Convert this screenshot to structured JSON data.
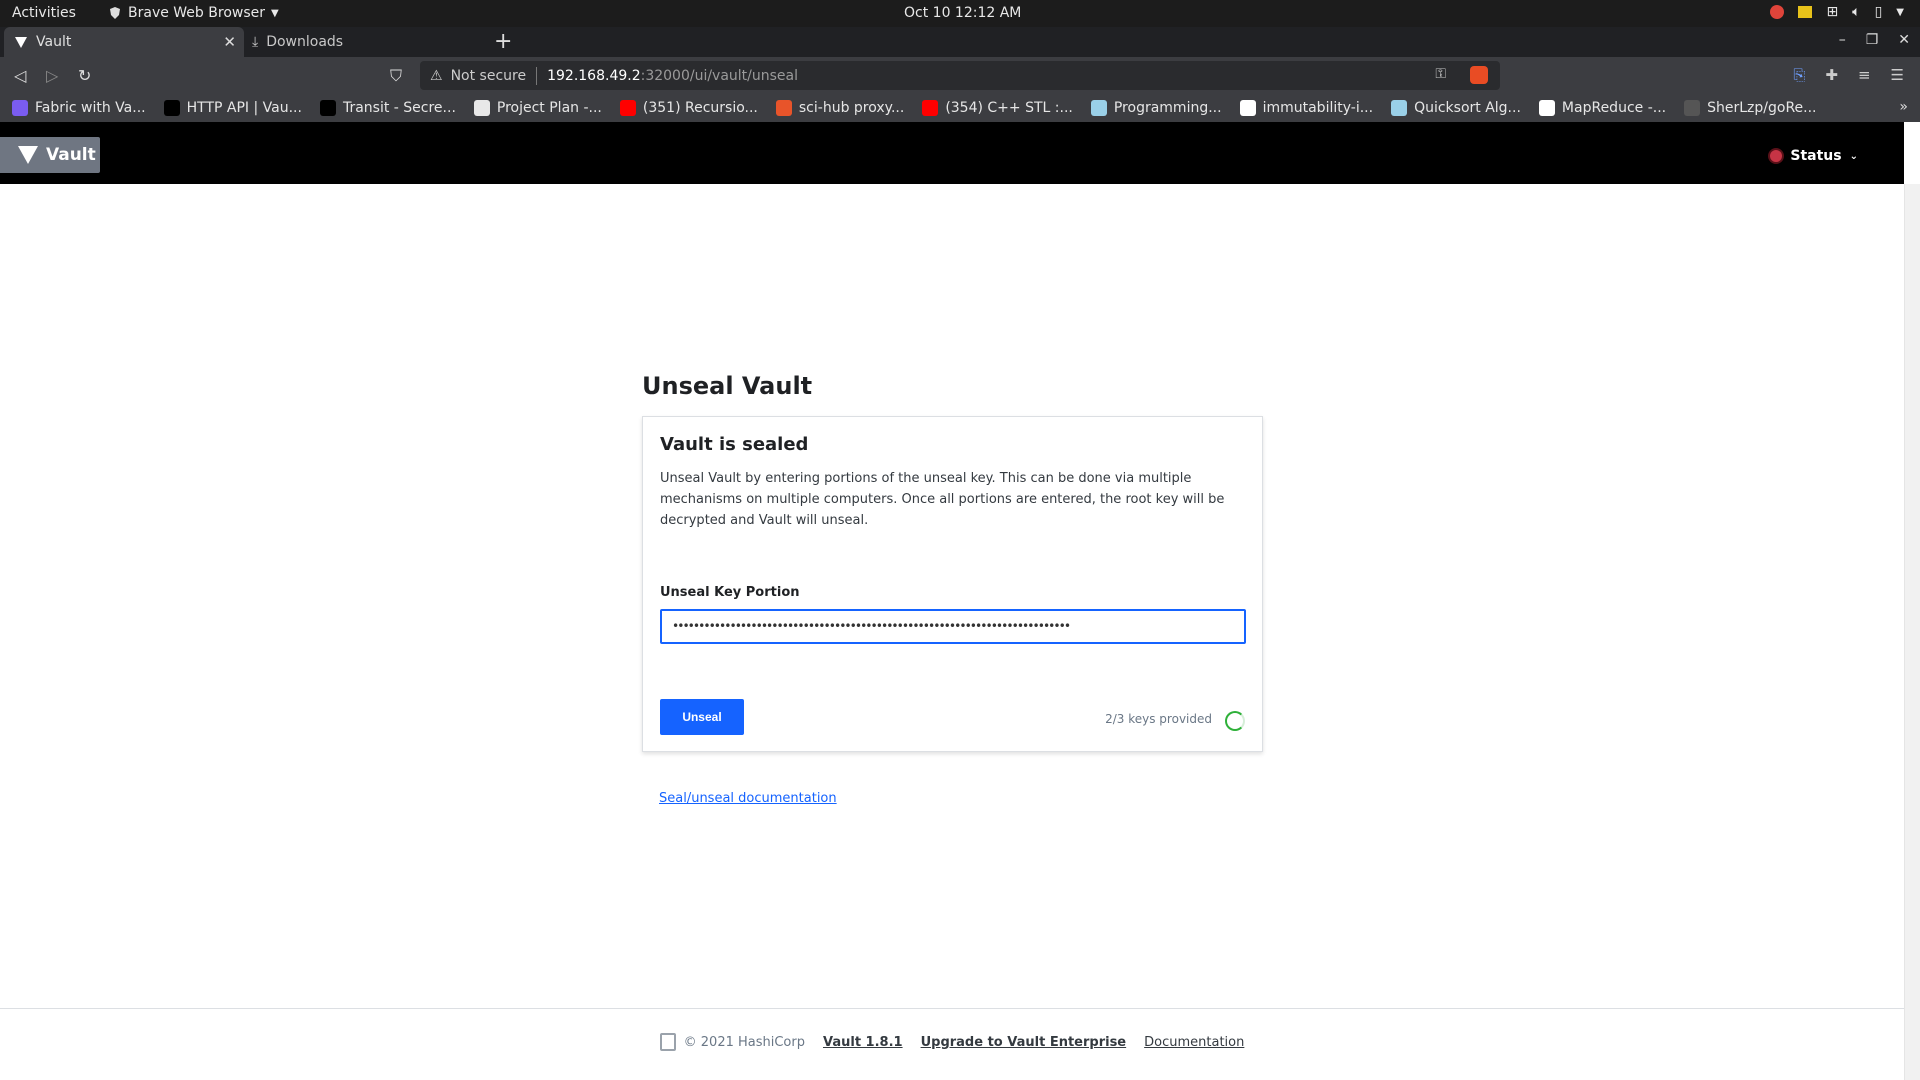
{
  "os_bar": {
    "activities": "Activities",
    "app_name": "Brave Web Browser",
    "clock": "Oct 10  12:12 AM"
  },
  "tabs": [
    {
      "title": "Vault",
      "active": true
    },
    {
      "title": "Downloads",
      "active": false
    }
  ],
  "address_bar": {
    "security_label": "Not secure",
    "host": "192.168.49.2",
    "path": ":32000/ui/vault/unseal"
  },
  "bookmarks": [
    {
      "label": "Fabric with Va...",
      "icon": "fabric-icon",
      "color": "#7a5cf0"
    },
    {
      "label": "HTTP API | Vau...",
      "icon": "vault-triangle-icon",
      "color": "#000000"
    },
    {
      "label": "Transit - Secre...",
      "icon": "vault-triangle-icon",
      "color": "#000000"
    },
    {
      "label": "Project Plan -...",
      "icon": "document-icon",
      "color": "#e8e8e8"
    },
    {
      "label": "(351) Recursio...",
      "icon": "youtube-icon",
      "color": "#ff0000"
    },
    {
      "label": "sci-hub proxy...",
      "icon": "scihub-icon",
      "color": "#e8542a"
    },
    {
      "label": "(354) C++ STL :...",
      "icon": "youtube-icon",
      "color": "#ff0000"
    },
    {
      "label": "Programming...",
      "icon": "mountain-icon",
      "color": "#9ad0e8"
    },
    {
      "label": "immutability-i...",
      "icon": "github-icon",
      "color": "#ffffff"
    },
    {
      "label": "Quicksort Alg...",
      "icon": "mountain-icon",
      "color": "#9ad0e8"
    },
    {
      "label": "MapReduce -...",
      "icon": "wikipedia-icon",
      "color": "#ffffff"
    },
    {
      "label": "SherLzp/goRe...",
      "icon": "github-icon",
      "color": "#555555"
    }
  ],
  "vault_nav": {
    "logo_text": "Vault",
    "status_label": "Status",
    "status_color": "#c73445"
  },
  "main": {
    "page_title": "Unseal Vault",
    "card_title": "Vault is sealed",
    "description": "Unseal Vault by entering portions of the unseal key. This can be done via multiple mechanisms on multiple computers. Once all portions are entered, the root key will be decrypted and Vault will unseal.",
    "field_label": "Unseal Key Portion",
    "field_value": "••••••••••••••••••••••••••••••••••••••••••••••••••••••••••••••••••••••••••••",
    "button_label": "Unseal",
    "keys_progress": "2/3 keys provided",
    "doc_link": "Seal/unseal documentation"
  },
  "footer": {
    "copyright": "© 2021 HashiCorp",
    "version": "Vault 1.8.1",
    "upgrade": "Upgrade to Vault Enterprise",
    "docs": "Documentation"
  },
  "colors": {
    "accent": "#1563ff",
    "nav_bg": "#000000",
    "progress_green": "#2eb039"
  }
}
